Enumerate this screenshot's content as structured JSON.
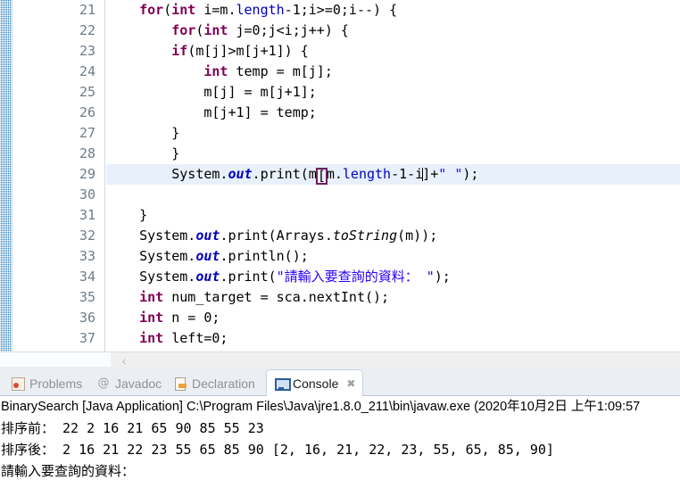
{
  "editor": {
    "first_line_number": 21,
    "current_line_number": 29,
    "lines": [
      {
        "num": "21",
        "indent": 0
      },
      {
        "num": "22",
        "indent": 0
      },
      {
        "num": "23",
        "indent": 0
      },
      {
        "num": "24",
        "indent": 0
      },
      {
        "num": "25",
        "indent": 0
      },
      {
        "num": "26",
        "indent": 0
      },
      {
        "num": "27",
        "indent": 0
      },
      {
        "num": "28",
        "indent": 0
      },
      {
        "num": "29",
        "indent": 0
      },
      {
        "num": "30",
        "indent": 0
      },
      {
        "num": "31",
        "indent": 0
      },
      {
        "num": "32",
        "indent": 0
      },
      {
        "num": "33",
        "indent": 0
      },
      {
        "num": "34",
        "indent": 0
      },
      {
        "num": "35",
        "indent": 0
      },
      {
        "num": "36",
        "indent": 0
      },
      {
        "num": "37",
        "indent": 0
      }
    ],
    "code_text": {
      "l21": "for(int i=m.length-1;i>=0;i--) {",
      "l22": "for(int j=0;j<i;j++) {",
      "l23": "if(m[j]>m[j+1]) {",
      "l24": "int temp = m[j];",
      "l25": "m[j] = m[j+1];",
      "l26": "m[j+1] = temp;",
      "l27": "}",
      "l28": "}",
      "l29": "System.out.print(m[m.length-1-i]+\" \");",
      "l30": "",
      "l31": "}",
      "l32": "System.out.print(Arrays.toString(m));",
      "l33": "System.out.println();",
      "l34": "System.out.print(\"請輸入要查詢的資料： \");",
      "l35": "int num_target = sca.nextInt();",
      "l36": "int n = 0;",
      "l37": "int left=0;"
    },
    "scrollbar": {
      "horizontal_left_arrow": "‹"
    }
  },
  "console_view": {
    "tabs": [
      {
        "label": "Problems",
        "icon": "problems-icon",
        "active": false
      },
      {
        "label": "Javadoc",
        "icon": "javadoc-icon",
        "active": false
      },
      {
        "label": "Declaration",
        "icon": "declaration-icon",
        "active": false
      },
      {
        "label": "Console",
        "icon": "console-icon",
        "active": true
      }
    ],
    "close_glyph": "✖",
    "javadoc_glyph": "@",
    "launch_line": "BinarySearch [Java Application] C:\\Program Files\\Java\\jre1.8.0_211\\bin\\javaw.exe (2020年10月2日 上午1:09:57",
    "output": [
      "排序前： 22 2 16 21 65 90 85 55 23",
      "排序後： 2 16 21 22 23 55 65 85 90 [2, 16, 21, 22, 23, 55, 65, 85, 90]",
      "請輸入要查詢的資料："
    ]
  },
  "colors": {
    "keyword": "#7f0055",
    "field": "#0000c0",
    "string": "#2a00ff",
    "current_line_highlight": "#e8f0fb",
    "bracket_match_border": "#6d2063",
    "scrollbar_blue": "#2a7fbe"
  }
}
